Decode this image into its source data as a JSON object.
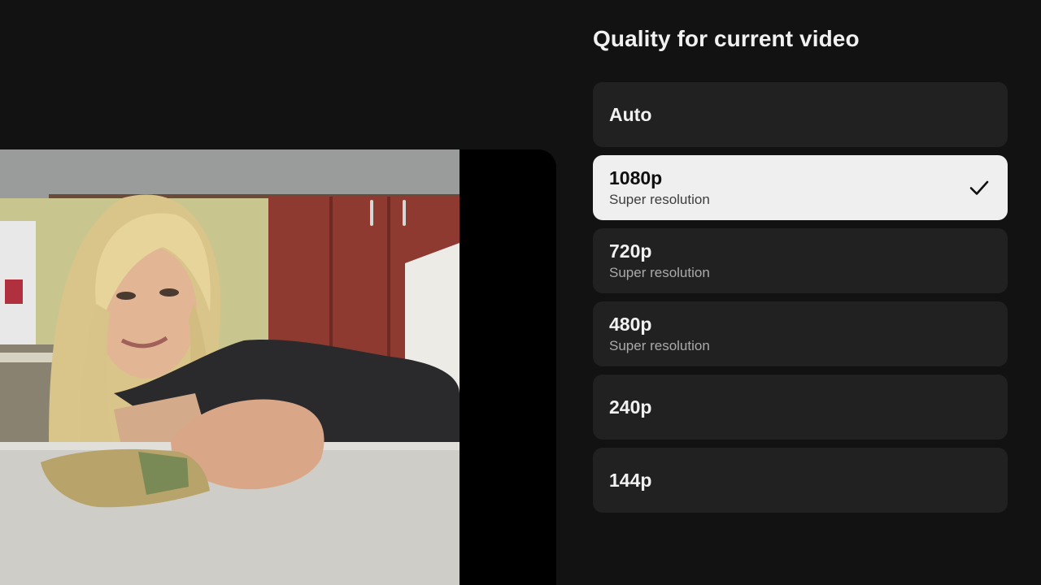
{
  "menu": {
    "title": "Quality for current video",
    "options": [
      {
        "label": "Auto",
        "sublabel": "",
        "selected": false
      },
      {
        "label": "1080p",
        "sublabel": "Super resolution",
        "selected": true
      },
      {
        "label": "720p",
        "sublabel": "Super resolution",
        "selected": false
      },
      {
        "label": "480p",
        "sublabel": "Super resolution",
        "selected": false
      },
      {
        "label": "240p",
        "sublabel": "",
        "selected": false
      },
      {
        "label": "144p",
        "sublabel": "",
        "selected": false
      }
    ],
    "selected_icon": "check-icon"
  },
  "video": {
    "thumbnail_icon": "video-preview"
  },
  "colors": {
    "background": "#121212",
    "option_bg": "#212121",
    "option_selected_bg": "#efefef",
    "text_primary": "#f1f1f1",
    "text_secondary": "#aaaaaa"
  }
}
